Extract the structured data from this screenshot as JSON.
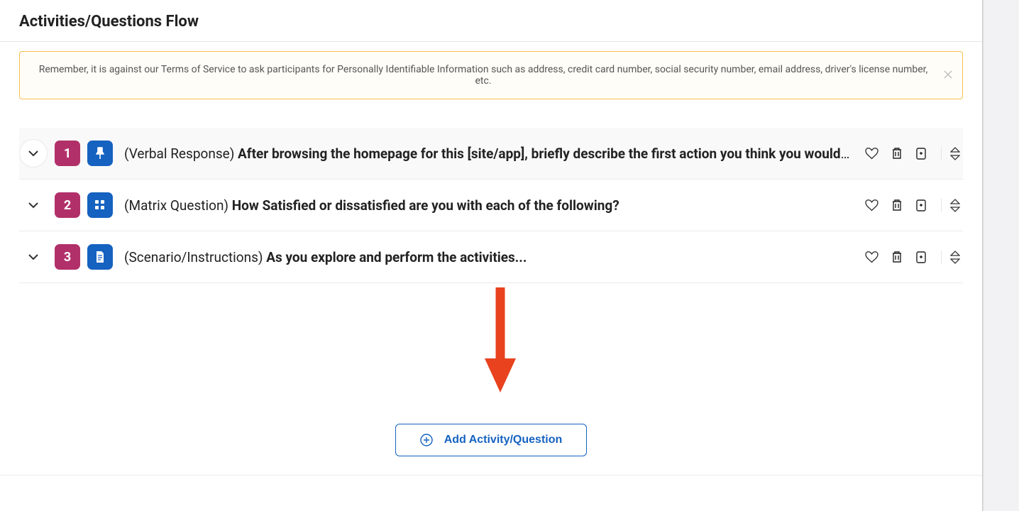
{
  "page_title": "Activities/Questions Flow",
  "alert": {
    "text": "Remember, it is against our Terms of Service to ask participants for Personally Identifiable Information such as address, credit card number, social security number, email address, driver's license number, etc."
  },
  "questions": [
    {
      "number": "1",
      "type_label": "(Verbal Response)",
      "title": "After browsing the homepage for this [site/app], briefly describe the first action you think you would …",
      "icon": "pin"
    },
    {
      "number": "2",
      "type_label": "(Matrix Question)",
      "title": "How Satisfied or dissatisfied are you with each of the following?",
      "icon": "matrix"
    },
    {
      "number": "3",
      "type_label": "(Scenario/Instructions)",
      "title": "As you explore and perform the activities...",
      "icon": "document"
    }
  ],
  "add_button_label": "Add Activity/Question"
}
